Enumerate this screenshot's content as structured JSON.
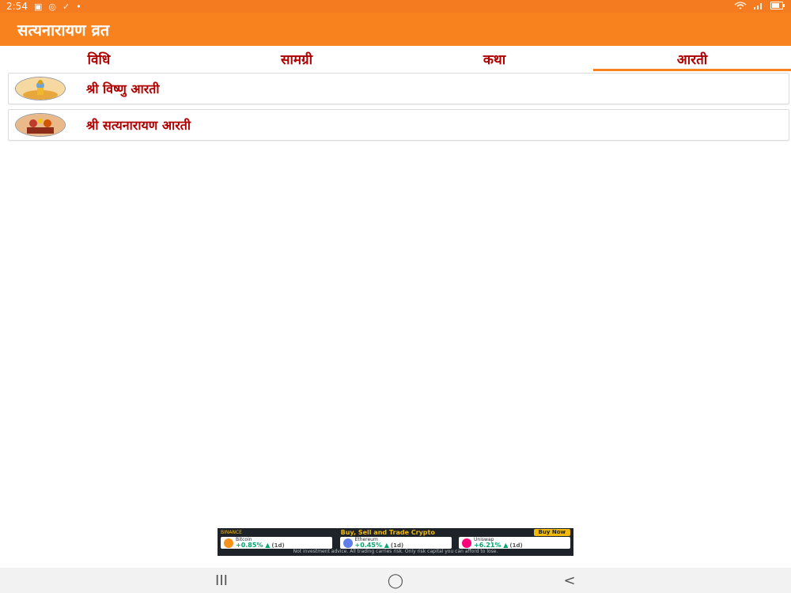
{
  "status_bar": {
    "time": "2:54"
  },
  "app": {
    "title": "सत्यनारायण व्रत",
    "accent": "#f7821e",
    "text_color": "#b00000"
  },
  "tabs": [
    {
      "label": "विधि",
      "active": false
    },
    {
      "label": "सामग्री",
      "active": false
    },
    {
      "label": "कथा",
      "active": false
    },
    {
      "label": "आरती",
      "active": true
    }
  ],
  "list": [
    {
      "label": "श्री विष्णु आरती",
      "icon": "vishnu-image"
    },
    {
      "label": "श्री सत्यनारायण आरती",
      "icon": "satyanarayan-image"
    }
  ],
  "ad": {
    "brand": "BINANCE",
    "headline": "Buy, Sell and Trade Crypto",
    "button": "Buy Now",
    "coins": [
      {
        "name": "Bitcoin",
        "change": "+0.85%",
        "period": "(1d)",
        "color": "#f7931a"
      },
      {
        "name": "Ethereum",
        "change": "+0.45%",
        "period": "(1d)",
        "color": "#627eea"
      },
      {
        "name": "Uniswap",
        "change": "+6.21%",
        "period": "(1d)",
        "color": "#ff007a"
      }
    ],
    "disclaimer": "Not investment advice. All trading carries risk. Only risk capital you can afford to lose."
  },
  "nav": {
    "recents": "III",
    "home": "◯",
    "back": "<"
  }
}
